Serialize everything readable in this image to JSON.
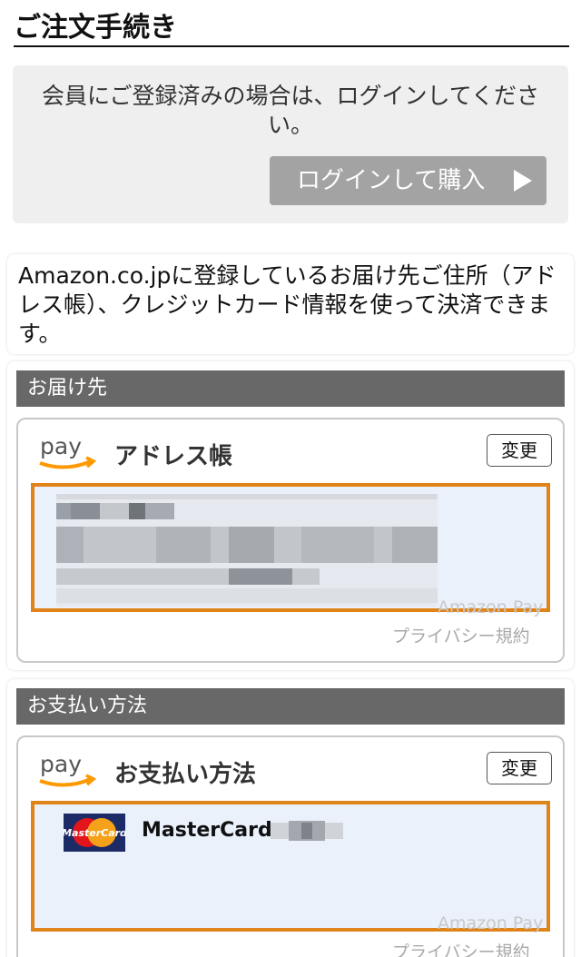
{
  "page": {
    "title": "ご注文手続き"
  },
  "login": {
    "message": "会員にご登録済みの場合は、ログインしてください。",
    "button_label": "ログインして購入"
  },
  "info": {
    "text": "Amazon.co.jpに登録しているお届け先ご住所（アドレス帳）、クレジットカード情報を使って決済できます。"
  },
  "shipping": {
    "header": "お届け先",
    "widget_title": "アドレス帳",
    "change_label": "変更",
    "watermark": "Amazon Pay",
    "privacy_label": "プライバシー規約"
  },
  "payment": {
    "header": "お支払い方法",
    "widget_title": "お支払い方法",
    "change_label": "変更",
    "card_name": "MasterCard",
    "card_logo_text": "MasterCard",
    "watermark": "Amazon Pay",
    "privacy_label": "プライバシー規約"
  },
  "logo": {
    "text": "pay",
    "color": "#ff9900"
  },
  "colors": {
    "accent_border": "#e0841a",
    "header_bg": "#686868",
    "login_button_bg": "#a3a3a3"
  }
}
